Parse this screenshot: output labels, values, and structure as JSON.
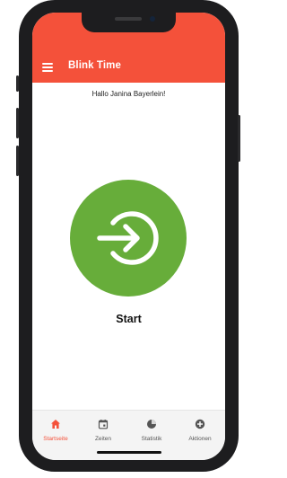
{
  "app": {
    "title": "Blink Time"
  },
  "header": {
    "menu_icon": "hamburger-menu-icon"
  },
  "main": {
    "greeting": "Hallo Janina Bayerlein!",
    "start_label": "Start",
    "start_icon": "login-arrow-icon"
  },
  "bottom_nav": {
    "items": [
      {
        "label": "Startseite",
        "icon": "home-icon",
        "active": true
      },
      {
        "label": "Zeiten",
        "icon": "calendar-icon",
        "active": false
      },
      {
        "label": "Statistik",
        "icon": "pie-chart-icon",
        "active": false
      },
      {
        "label": "Aktionen",
        "icon": "add-circle-icon",
        "active": false
      }
    ]
  },
  "colors": {
    "accent": "#f4513a",
    "start_button": "#67ad3a",
    "nav_inactive": "#555555"
  }
}
